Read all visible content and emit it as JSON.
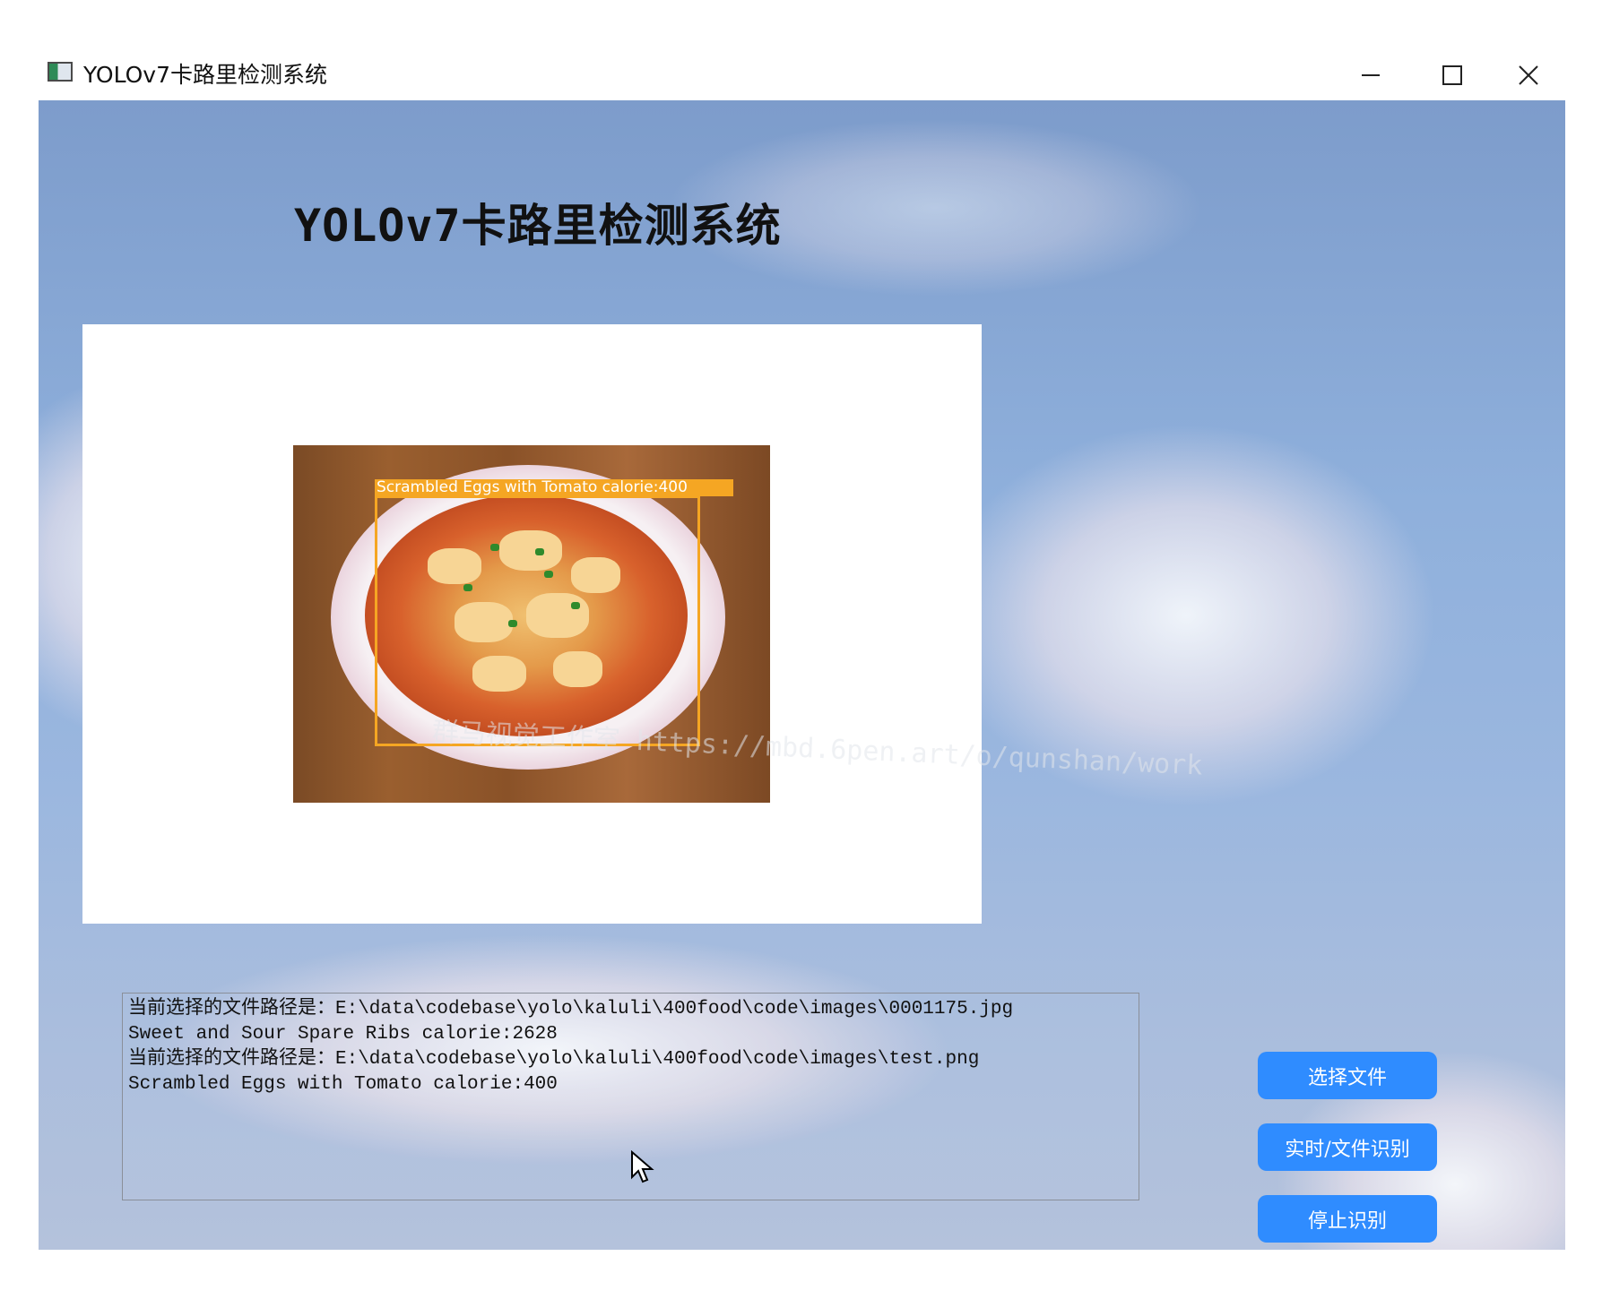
{
  "window": {
    "title": "YOLOv7卡路里检测系统"
  },
  "header": {
    "title": "YOLOv7卡路里检测系统"
  },
  "image_panel": {
    "detection_label": "Scrambled Eggs with Tomato calorie:400",
    "box_color": "#f5a623"
  },
  "watermark": {
    "text": "群马视觉工作室 https://mbd.6pen.art/o/qunshan/work"
  },
  "log": {
    "lines": [
      "当前选择的文件路径是：E:\\data\\codebase\\yolo\\kaluli\\400food\\code\\images\\0001175.jpg",
      "Sweet and Sour Spare Ribs calorie:2628",
      "当前选择的文件路径是：E:\\data\\codebase\\yolo\\kaluli\\400food\\code\\images\\test.png",
      "Scrambled Eggs with Tomato calorie:400"
    ]
  },
  "buttons": {
    "select_file": "选择文件",
    "realtime_file": "实时/文件识别",
    "stop": "停止识别"
  },
  "colors": {
    "button": "#2f8cff",
    "panel": "#ffffff"
  }
}
